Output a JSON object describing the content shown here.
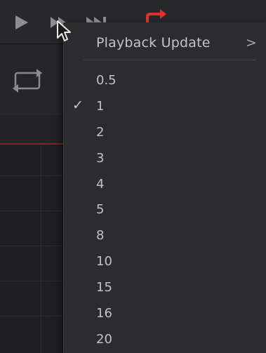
{
  "toolbar": {
    "buttons": [
      {
        "icon": "play-icon",
        "color": "#8e8e92"
      },
      {
        "icon": "play-every-frame-icon",
        "color": "#8e8e92"
      },
      {
        "icon": "step-forward-icon",
        "color": "#8e8e92"
      },
      {
        "icon": "loop-playback-icon",
        "color": "#e0322a"
      }
    ]
  },
  "panel": {
    "loop_icon": "loop-toggle-icon",
    "accent_color": "#7a2a26"
  },
  "menu": {
    "header_label": "Playback Update",
    "submenu_arrow": ">",
    "items": [
      {
        "label": "0.5",
        "checked": false
      },
      {
        "label": "1",
        "checked": true
      },
      {
        "label": "2",
        "checked": false
      },
      {
        "label": "3",
        "checked": false
      },
      {
        "label": "4",
        "checked": false
      },
      {
        "label": "5",
        "checked": false
      },
      {
        "label": "8",
        "checked": false
      },
      {
        "label": "10",
        "checked": false
      },
      {
        "label": "15",
        "checked": false
      },
      {
        "label": "16",
        "checked": false
      },
      {
        "label": "20",
        "checked": false
      }
    ],
    "check_glyph": "✓"
  }
}
